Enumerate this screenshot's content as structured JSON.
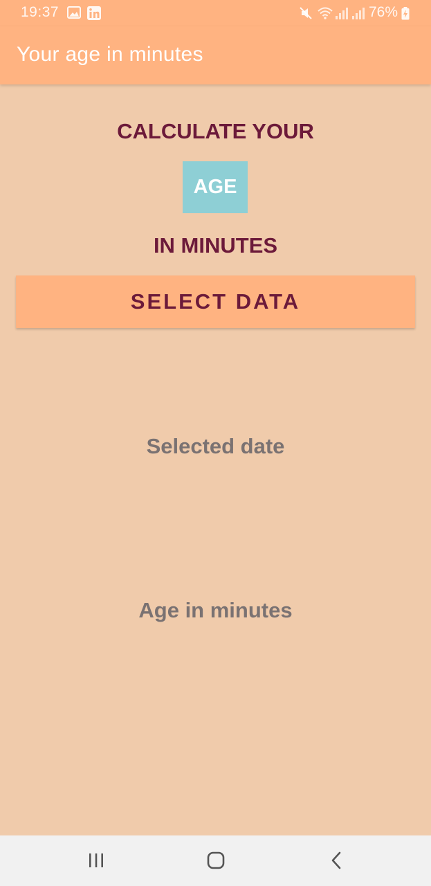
{
  "status_bar": {
    "time": "19:37",
    "battery": "76%",
    "icons": [
      "gallery-icon",
      "linkedin-icon",
      "mute-icon",
      "wifi-icon",
      "signal-icon",
      "signal-icon",
      "battery-charging-icon"
    ]
  },
  "app_bar": {
    "title": "Your age in minutes"
  },
  "main": {
    "heading_top": "CALCULATE YOUR",
    "age_label": "AGE",
    "heading_bottom": "IN MINUTES",
    "select_button_label": "SELECT DATA",
    "selected_date_text": "Selected date",
    "age_in_minutes_text": "Age in minutes"
  },
  "nav_bar": {
    "icons": [
      "recent-apps-icon",
      "home-icon",
      "back-icon"
    ]
  },
  "colors": {
    "primary": "#FFB381",
    "background": "#F0CBAB",
    "accent_text": "#6C1A3A",
    "age_box": "#8ECFD5",
    "info_text": "#7A7272"
  }
}
